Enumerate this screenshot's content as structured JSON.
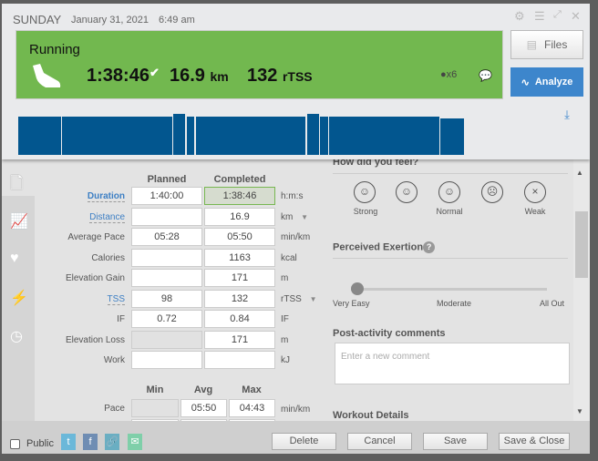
{
  "header": {
    "day": "SUNDAY",
    "date": "January 31, 2021",
    "time": "6:49 am",
    "icons": [
      "gear-icon",
      "menu-icon",
      "expand-icon",
      "close-icon"
    ]
  },
  "summary": {
    "sport": "Running",
    "duration": "1:38:46",
    "distance": "16.9",
    "distance_unit": "km",
    "tss": "132",
    "tss_unit": "rTSS",
    "equipment_count": "x6",
    "bg_color": "#72b84f"
  },
  "buttons": {
    "files": "Files",
    "analyze": "Analyze",
    "analyze_color": "#3d86cc"
  },
  "workout_structure": {
    "color": "#02568f",
    "segments": [
      {
        "duration_pct": 7.8,
        "intensity": "base"
      },
      {
        "duration_pct": 19.8,
        "intensity": "base"
      },
      {
        "duration_pct": 2.4,
        "intensity": "high"
      },
      {
        "duration_pct": 1.6,
        "intensity": "base"
      },
      {
        "duration_pct": 19.8,
        "intensity": "base"
      },
      {
        "duration_pct": 2.4,
        "intensity": "high"
      },
      {
        "duration_pct": 1.6,
        "intensity": "base"
      },
      {
        "duration_pct": 19.8,
        "intensity": "base"
      },
      {
        "duration_pct": 4.4,
        "intensity": "low"
      }
    ]
  },
  "nav": {
    "items": [
      "summary",
      "graph",
      "heart",
      "power",
      "time"
    ]
  },
  "table": {
    "planned_header": "Planned",
    "completed_header": "Completed",
    "rows": [
      {
        "label": "Duration",
        "planned": "1:40:00",
        "completed": "1:38:46",
        "unit": "h:m:s"
      },
      {
        "label": "Distance",
        "planned": "",
        "completed": "16.9",
        "unit": "km"
      },
      {
        "label": "Average Pace",
        "planned": "05:28",
        "completed": "05:50",
        "unit": "min/km"
      },
      {
        "label": "Calories",
        "planned": "",
        "completed": "1163",
        "unit": "kcal"
      },
      {
        "label": "Elevation Gain",
        "planned": "",
        "completed": "171",
        "unit": "m"
      },
      {
        "label": "TSS",
        "planned": "98",
        "completed": "132",
        "unit": "rTSS"
      },
      {
        "label": "IF",
        "planned": "0.72",
        "completed": "0.84",
        "unit": "IF"
      },
      {
        "label": "Elevation Loss",
        "planned": "",
        "completed": "171",
        "unit": "m"
      },
      {
        "label": "Work",
        "planned": "",
        "completed": "",
        "unit": "kJ"
      }
    ]
  },
  "minmax": {
    "min": "Min",
    "avg": "Avg",
    "max": "Max",
    "rows": [
      {
        "label": "Pace",
        "min": "",
        "avg": "05:50",
        "max": "04:43",
        "unit": "min/km"
      }
    ]
  },
  "feel": {
    "title": "How did you feel?",
    "labels": {
      "strong": "Strong",
      "normal": "Normal",
      "weak": "Weak"
    }
  },
  "exertion": {
    "title": "Perceived Exertion",
    "value": 0,
    "min_label": "Very Easy",
    "mid_label": "Moderate",
    "max_label": "All Out"
  },
  "comments": {
    "title": "Post-activity comments",
    "placeholder": "Enter a new comment"
  },
  "details": {
    "title": "Workout Details"
  },
  "footer": {
    "public": "Public",
    "public_checked": false,
    "delete": "Delete",
    "cancel": "Cancel",
    "save": "Save",
    "save_close": "Save & Close"
  }
}
